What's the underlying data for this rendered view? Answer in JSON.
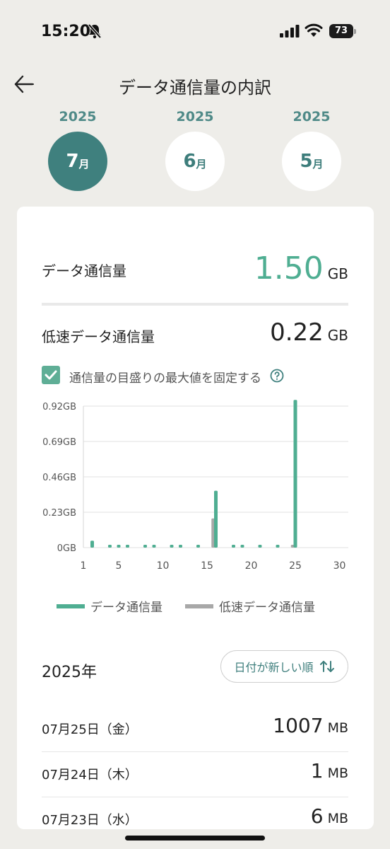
{
  "status_bar": {
    "time": "15:20",
    "battery": "73"
  },
  "header": {
    "title": "データ通信量の内訳"
  },
  "months": [
    {
      "year": "2025",
      "month": "7",
      "unit": "月",
      "active": true
    },
    {
      "year": "2025",
      "month": "6",
      "unit": "月",
      "active": false
    },
    {
      "year": "2025",
      "month": "5",
      "unit": "月",
      "active": false
    }
  ],
  "summary": {
    "data_label": "データ通信量",
    "data_value": "1.50",
    "data_unit": "GB",
    "low_label": "低速データ通信量",
    "low_value": "0.22",
    "low_unit": "GB",
    "fix_scale_label": "通信量の目盛りの最大値を固定する",
    "fix_scale_checked": true
  },
  "colors": {
    "accent": "#4fae92",
    "low": "#a8a8a8",
    "teal": "#3f807e"
  },
  "chart_data": {
    "type": "bar",
    "y_ticks": [
      "0GB",
      "0.23GB",
      "0.46GB",
      "0.69GB",
      "0.92GB"
    ],
    "x_ticks": [
      "1",
      "5",
      "10",
      "15",
      "20",
      "25",
      "30"
    ],
    "ylim": [
      0,
      0.92
    ],
    "xlim": [
      1,
      31
    ],
    "unit": "GB",
    "series": [
      {
        "name": "データ通信量",
        "points": [
          [
            2,
            0.045
          ],
          [
            4,
            0.005
          ],
          [
            5,
            0.005
          ],
          [
            6,
            0.005
          ],
          [
            8,
            0.005
          ],
          [
            9,
            0.005
          ],
          [
            11,
            0.005
          ],
          [
            12,
            0.005
          ],
          [
            14,
            0.005
          ],
          [
            16,
            0.37
          ],
          [
            18,
            0.005
          ],
          [
            19,
            0.005
          ],
          [
            21,
            0.005
          ],
          [
            23,
            0.005
          ],
          [
            25,
            0.96
          ]
        ]
      },
      {
        "name": "低速データ通信量",
        "points": [
          [
            15.7,
            0.19
          ],
          [
            24.7,
            0.01
          ]
        ]
      }
    ]
  },
  "legend": {
    "data": "データ通信量",
    "low": "低速データ通信量"
  },
  "list": {
    "year_heading": "2025年",
    "sort_label": "日付が新しい順",
    "rows": [
      {
        "date": "07月25日（金）",
        "value": "1007",
        "unit": "MB"
      },
      {
        "date": "07月24日（木）",
        "value": "1",
        "unit": "MB"
      },
      {
        "date": "07月23日（水）",
        "value": "6",
        "unit": "MB"
      }
    ]
  }
}
